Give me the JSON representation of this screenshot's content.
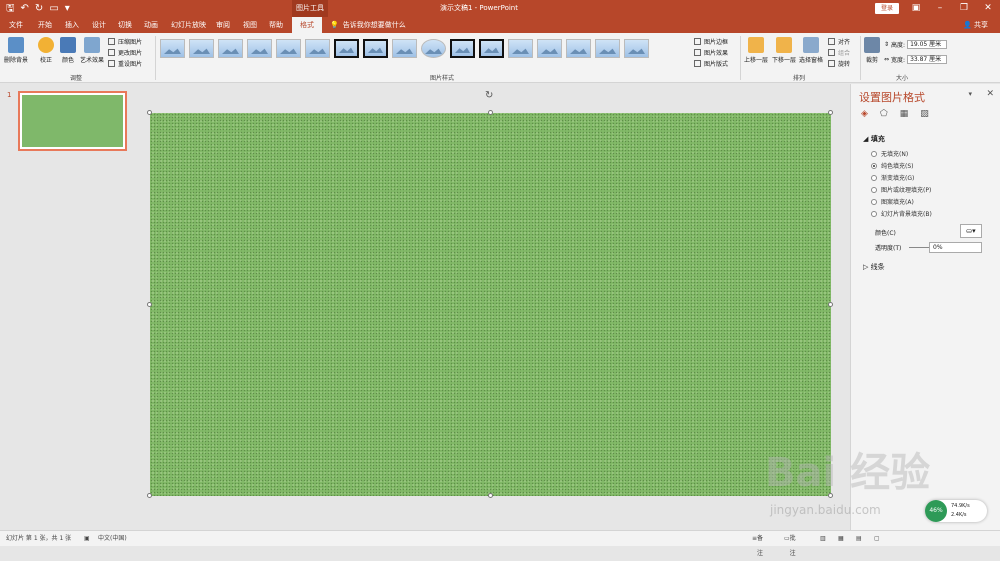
{
  "titlebar": {
    "qat": [
      "save-icon",
      "undo-icon",
      "redo-icon",
      "start-icon",
      "customize-icon"
    ],
    "context_tools": "图片工具",
    "doc_title": "演示文稿1  -  PowerPoint",
    "login": "登录",
    "controls": [
      "ribbon-display-icon",
      "minimize-icon",
      "restore-icon",
      "close-icon"
    ]
  },
  "tabs": [
    "文件",
    "开始",
    "插入",
    "设计",
    "切换",
    "动画",
    "幻灯片放映",
    "审阅",
    "视图",
    "帮助",
    "格式"
  ],
  "active_tab": "格式",
  "tellme": "告诉我你想要做什么",
  "share": "共享",
  "ribbon": {
    "remove_bg": "删除背景",
    "correct": "校正",
    "color": "颜色",
    "artistic": "艺术效果",
    "compress": "压缩图片",
    "change": "更改图片",
    "reset": "重设图片",
    "group_adjust": "调整",
    "group_styles": "图片样式",
    "border": "图片边框",
    "effects": "图片效果",
    "layout": "图片版式",
    "bring_forward": "上移一层",
    "send_backward": "下移一层",
    "selection_pane": "选择窗格",
    "align": "对齐",
    "group": "组合",
    "rotate": "旋转",
    "group_arrange": "排列",
    "crop": "裁剪",
    "height_label": "高度:",
    "height_value": "19.05 厘米",
    "width_label": "宽度:",
    "width_value": "33.87 厘米",
    "group_size": "大小"
  },
  "slides": {
    "number": "1"
  },
  "format_pane": {
    "title": "设置图片格式",
    "fill_header": "填充",
    "options": [
      "无填充(N)",
      "纯色填充(S)",
      "渐变填充(G)",
      "图片或纹理填充(P)",
      "图案填充(A)",
      "幻灯片背景填充(B)"
    ],
    "selected_option": "纯色填充(S)",
    "color_label": "颜色(C)",
    "transparency_label": "透明度(T)",
    "transparency_value": "0%",
    "line_header": "线条"
  },
  "statusbar": {
    "slide_info": "幻灯片 第 1 张，共 1 张",
    "language": "中文(中国)",
    "notes": "备注",
    "comments": "批注"
  },
  "network": {
    "up": "74.9K/s",
    "down": "2.4K/s",
    "percent": "46%"
  },
  "watermark": {
    "main": "Bai 经验",
    "sub": "jingyan.baidu.com"
  },
  "colors": {
    "accent": "#b7472a",
    "slide_fill": "#82ba68"
  }
}
